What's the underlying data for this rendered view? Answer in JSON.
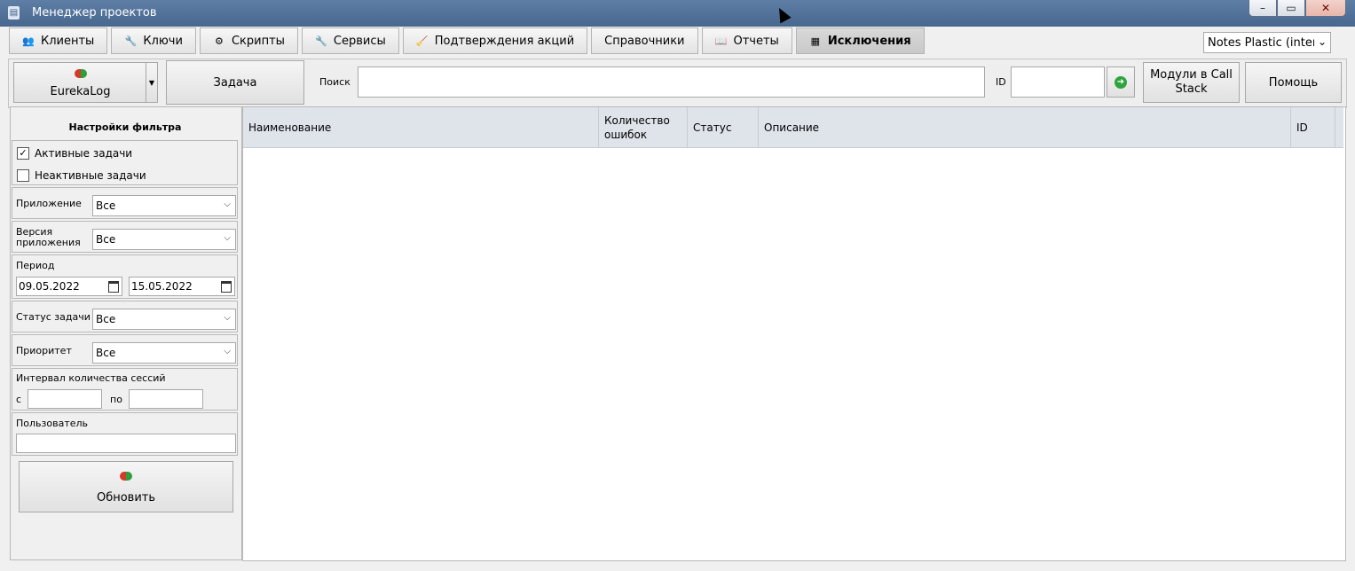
{
  "window": {
    "title": "Менеджер проектов",
    "minimize": "–",
    "maximize": "▭",
    "close": "✕"
  },
  "tabs": [
    {
      "label": "Клиенты",
      "icon": "users-icon",
      "glyph": "👥"
    },
    {
      "label": "Ключи",
      "icon": "key-icon",
      "glyph": "🔧"
    },
    {
      "label": "Скрипты",
      "icon": "script-icon",
      "glyph": "⚙"
    },
    {
      "label": "Сервисы",
      "icon": "wrench-icon",
      "glyph": "🔧"
    },
    {
      "label": "Подтверждения акций",
      "icon": "broom-icon",
      "glyph": "🧹"
    },
    {
      "label": "Справочники",
      "icon": "",
      "glyph": ""
    },
    {
      "label": "Отчеты",
      "icon": "report-icon",
      "glyph": "📖"
    },
    {
      "label": "Исключения",
      "icon": "table-icon",
      "glyph": "▦"
    }
  ],
  "active_tab": "Исключения",
  "project_select": {
    "value": "Notes Plastic (interna"
  },
  "toolbar": {
    "eureka_label": "EurekaLog",
    "task_label": "Задача",
    "search_label": "Поиск",
    "search_value": "",
    "id_label": "ID",
    "id_value": "",
    "modules_label": "Модули в Call Stack",
    "help_label": "Помощь"
  },
  "filter": {
    "title": "Настройки фильтра",
    "active_tasks": {
      "label": "Активные задачи",
      "checked": true,
      "mark": "✓"
    },
    "inactive_tasks": {
      "label": "Неактивные задачи",
      "checked": false,
      "mark": ""
    },
    "application": {
      "label": "Приложение",
      "value": "Все"
    },
    "app_version": {
      "label": "Версия приложения",
      "value": "Все"
    },
    "period": {
      "label": "Период",
      "from": "09.05.2022",
      "to": "15.05.2022"
    },
    "task_status": {
      "label": "Статус задачи",
      "value": "Все"
    },
    "priority": {
      "label": "Приоритет",
      "value": "Все"
    },
    "session_interval": {
      "label": "Интервал количества сессий",
      "from_label": "с",
      "to_label": "по",
      "from": "",
      "to": ""
    },
    "user": {
      "label": "Пользователь",
      "value": ""
    },
    "refresh_label": "Обновить"
  },
  "grid": {
    "columns": [
      "Наименование",
      "Количество ошибок",
      "Статус",
      "Описание",
      "ID"
    ],
    "rows": []
  }
}
